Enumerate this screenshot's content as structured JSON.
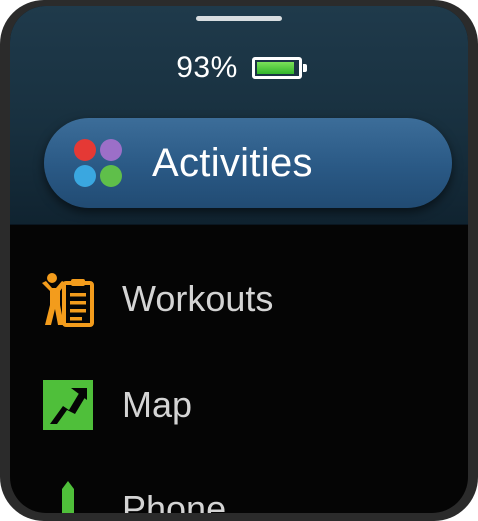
{
  "status": {
    "battery_text": "93%",
    "battery_level": 0.93,
    "battery_color": "#32b52b"
  },
  "activities_button": {
    "label": "Activities",
    "icon": "four-dots-icon",
    "dot_colors": [
      "#e53935",
      "#9c6fc8",
      "#3aa7e0",
      "#5fbf4a"
    ]
  },
  "menu": {
    "items": [
      {
        "label": "Workouts",
        "icon": "workout-clipboard-icon",
        "icon_color": "#f39c1c"
      },
      {
        "label": "Map",
        "icon": "map-icon",
        "icon_color": "#4fbf3a"
      },
      {
        "label": "Phone",
        "icon": "phone-icon",
        "icon_color": "#4fbf3a"
      }
    ]
  }
}
